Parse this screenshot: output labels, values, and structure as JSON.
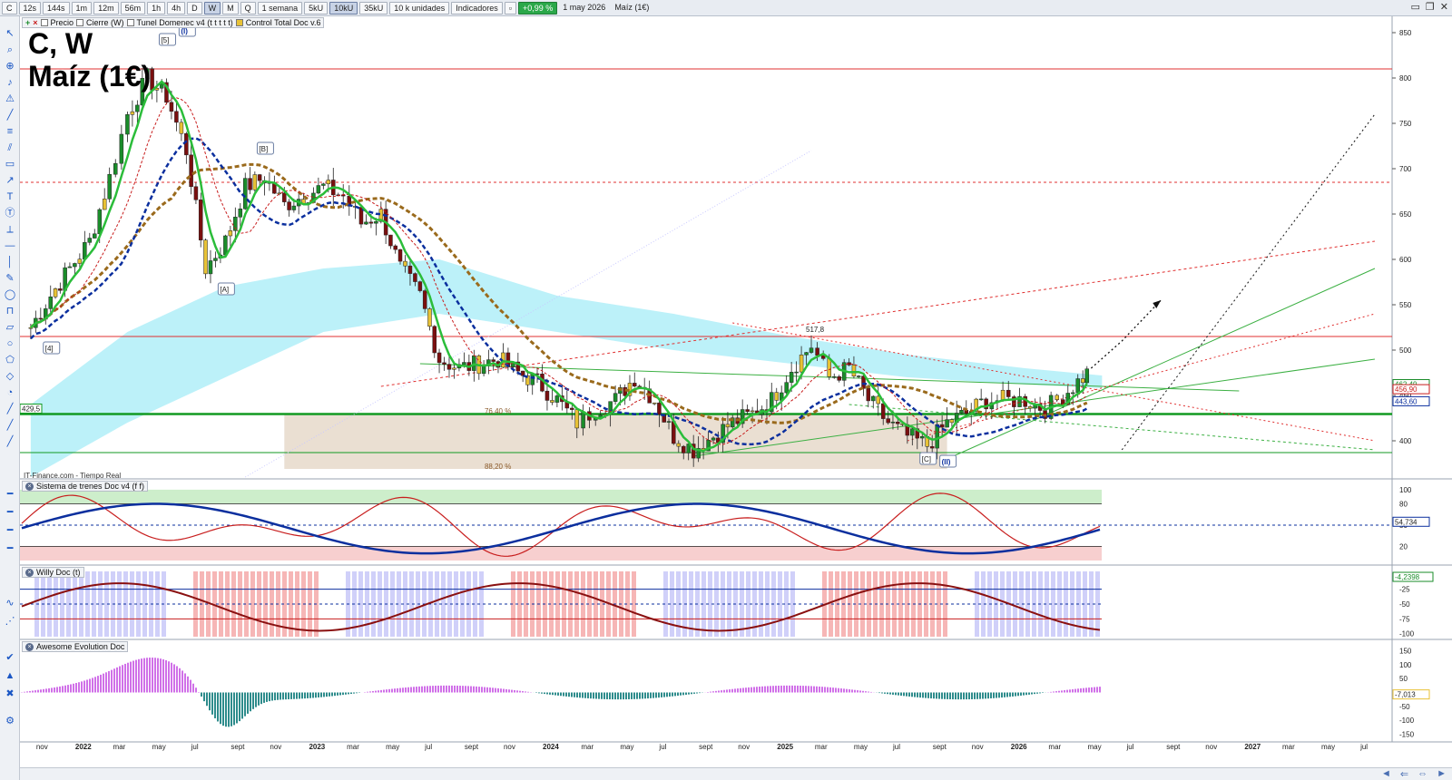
{
  "toolbar": {
    "symbol": "C",
    "timeframes": [
      "12s",
      "144s",
      "1m",
      "12m",
      "56m",
      "1h",
      "4h",
      "D",
      "W",
      "M",
      "Q"
    ],
    "active_timeframe": "W",
    "period": "1 semana",
    "units": [
      "5kU",
      "10kU",
      "35kU"
    ],
    "active_unit": "10kU",
    "units_menu": "10 k unidades",
    "indicators": "Indicadores",
    "change_badge": "+0,99 %",
    "date_label": "1 may 2026",
    "instrument": "Maíz (1€)"
  },
  "legend": {
    "items": [
      "Precio",
      "Cierre (W)",
      "Tunel Domenec v4 (t t t t t)",
      "Control Total Doc v.6"
    ]
  },
  "title": {
    "line1": "C, W",
    "line2": "Maíz (1€)"
  },
  "source": "IT-Finance.com - Tiempo Real",
  "panes": {
    "trenes": "Sistema de trenes Doc v4 (f f)",
    "willy": "Willy Doc (t)",
    "awesome": "Awesome Evolution Doc"
  },
  "colors": {
    "up": "#1a8c2a",
    "down": "#c81e1e",
    "neutral": "#e8c235",
    "accent": "#0b2f9e"
  },
  "chart_data": [
    {
      "type": "candlestick",
      "title": "C, W",
      "subtitle": "Maíz (1€)",
      "ylim": [
        360,
        860
      ],
      "y_ticks": [
        400,
        450,
        500,
        550,
        600,
        650,
        700,
        750,
        800,
        850
      ],
      "x_ticks": [
        "nov",
        "2022",
        "mar",
        "may",
        "jul",
        "sept",
        "nov",
        "2023",
        "mar",
        "may",
        "jul",
        "sept",
        "nov",
        "2024",
        "mar",
        "may",
        "jul",
        "sept",
        "nov",
        "2025",
        "mar",
        "may",
        "jul",
        "sept",
        "nov",
        "2026",
        "mar",
        "may",
        "jul",
        "sept",
        "nov",
        "2027",
        "mar",
        "may",
        "jul"
      ],
      "close_series": [
        {
          "d": "2021-10",
          "v": 525
        },
        {
          "d": "2021-11",
          "v": 560
        },
        {
          "d": "2021-12",
          "v": 590
        },
        {
          "d": "2022-01",
          "v": 620
        },
        {
          "d": "2022-02",
          "v": 690
        },
        {
          "d": "2022-03",
          "v": 760
        },
        {
          "d": "2022-04",
          "v": 800
        },
        {
          "d": "2022-05",
          "v": 780
        },
        {
          "d": "2022-06",
          "v": 720
        },
        {
          "d": "2022-07",
          "v": 590
        },
        {
          "d": "2022-08",
          "v": 620
        },
        {
          "d": "2022-09",
          "v": 680
        },
        {
          "d": "2022-10",
          "v": 690
        },
        {
          "d": "2022-11",
          "v": 660
        },
        {
          "d": "2022-12",
          "v": 670
        },
        {
          "d": "2023-01",
          "v": 680
        },
        {
          "d": "2023-02",
          "v": 670
        },
        {
          "d": "2023-03",
          "v": 640
        },
        {
          "d": "2023-04",
          "v": 650
        },
        {
          "d": "2023-05",
          "v": 590
        },
        {
          "d": "2023-06",
          "v": 560
        },
        {
          "d": "2023-07",
          "v": 490
        },
        {
          "d": "2023-08",
          "v": 480
        },
        {
          "d": "2023-09",
          "v": 485
        },
        {
          "d": "2023-10",
          "v": 490
        },
        {
          "d": "2023-11",
          "v": 475
        },
        {
          "d": "2023-12",
          "v": 465
        },
        {
          "d": "2024-01",
          "v": 445
        },
        {
          "d": "2024-02",
          "v": 420
        },
        {
          "d": "2024-03",
          "v": 435
        },
        {
          "d": "2024-04",
          "v": 445
        },
        {
          "d": "2024-05",
          "v": 470
        },
        {
          "d": "2024-06",
          "v": 445
        },
        {
          "d": "2024-07",
          "v": 405
        },
        {
          "d": "2024-08",
          "v": 390
        },
        {
          "d": "2024-09",
          "v": 405
        },
        {
          "d": "2024-10",
          "v": 420
        },
        {
          "d": "2024-11",
          "v": 430
        },
        {
          "d": "2024-12",
          "v": 445
        },
        {
          "d": "2025-01",
          "v": 480
        },
        {
          "d": "2025-02",
          "v": 505
        },
        {
          "d": "2025-03",
          "v": 470
        },
        {
          "d": "2025-04",
          "v": 480
        },
        {
          "d": "2025-05",
          "v": 445
        },
        {
          "d": "2025-06",
          "v": 420
        },
        {
          "d": "2025-07",
          "v": 405
        },
        {
          "d": "2025-08",
          "v": 395
        },
        {
          "d": "2025-09",
          "v": 420
        },
        {
          "d": "2025-10",
          "v": 430
        },
        {
          "d": "2025-11",
          "v": 445
        },
        {
          "d": "2026-01",
          "v": 445
        },
        {
          "d": "2026-02",
          "v": 435
        },
        {
          "d": "2026-03",
          "v": 450
        },
        {
          "d": "2026-04",
          "v": 470
        },
        {
          "d": "2026-04-28",
          "v": 478
        }
      ],
      "levels": [
        {
          "label": "",
          "value": 810,
          "style": "solid",
          "color": "#e03030"
        },
        {
          "label": "",
          "value": 685,
          "style": "dashed",
          "color": "#e03030"
        },
        {
          "label": "",
          "value": 515,
          "style": "solid",
          "color": "#e03030"
        },
        {
          "label": "429,5",
          "value": 429.5,
          "style": "solid",
          "color": "#129a22"
        },
        {
          "label": "",
          "value": 387,
          "style": "solid",
          "color": "#129a22"
        }
      ],
      "annotations": [
        {
          "label": "[5]",
          "d": "2022-05",
          "v": 840
        },
        {
          "label": "(I)",
          "d": "2022-06",
          "v": 850
        },
        {
          "label": "[4]",
          "d": "2021-11",
          "v": 500
        },
        {
          "label": "[A]",
          "d": "2022-08",
          "v": 565
        },
        {
          "label": "[B]",
          "d": "2022-10",
          "v": 720
        },
        {
          "label": "[C]",
          "d": "2025-08",
          "v": 378
        },
        {
          "label": "(II)",
          "d": "2025-09",
          "v": 375
        },
        {
          "label": "517,8",
          "d": "2025-02",
          "v": 521
        },
        {
          "label": "76,40 %",
          "d": "2023-10",
          "v": 431
        },
        {
          "label": "88,20 %",
          "d": "2023-10",
          "v": 370
        }
      ],
      "price_tags": [
        {
          "label": "462,49",
          "value": 462.49,
          "color": "#1a8c2a"
        },
        {
          "label": "456,90",
          "value": 456.9,
          "color": "#c81e1e"
        },
        {
          "label": "443,60",
          "value": 443.6,
          "color": "#0b2f9e"
        }
      ]
    },
    {
      "type": "line",
      "name": "Sistema de trenes Doc v4 (f f)",
      "ylim": [
        0,
        105
      ],
      "y_ticks": [
        20,
        50,
        80,
        100
      ],
      "price_tags": [
        "54,734"
      ]
    },
    {
      "type": "line",
      "name": "Willy Doc (t)",
      "ylim": [
        -105,
        5
      ],
      "y_ticks": [
        -25,
        -50,
        -75,
        -100
      ],
      "price_tags": [
        "-4,2398"
      ]
    },
    {
      "type": "bar",
      "name": "Awesome Evolution Doc",
      "ylim": [
        -165,
        165
      ],
      "y_ticks": [
        150,
        100,
        50,
        -50,
        -100,
        -150
      ],
      "price_tags": [
        "-7,013"
      ]
    }
  ]
}
